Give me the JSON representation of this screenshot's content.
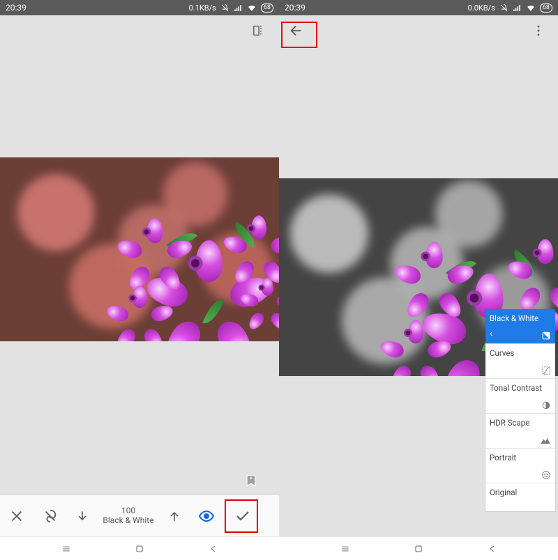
{
  "left": {
    "status": {
      "time": "20:39",
      "net": "0.1KB/s",
      "battery": "68"
    },
    "topbar_icon": "compare-icon",
    "bookmark_icon": "bookmark-add-icon",
    "toolbar": {
      "close": "close-icon",
      "mask": "mask-brush-icon",
      "down": "arrow-down-icon",
      "value": "100",
      "label": "Black & White",
      "up": "arrow-up-icon",
      "eye": "eye-icon",
      "apply": "check-icon"
    }
  },
  "right": {
    "status": {
      "time": "20:39",
      "net": "0.0KB/s",
      "battery": "68"
    },
    "menu_icon": "more-vert-icon",
    "back_icon": "arrow-back-icon",
    "stacks": [
      {
        "label": "Black & White",
        "icon": "bw-icon",
        "active": true
      },
      {
        "label": "Curves",
        "icon": "curves-icon"
      },
      {
        "label": "Tonal Contrast",
        "icon": "tonal-icon"
      },
      {
        "label": "HDR Scape",
        "icon": "hdr-icon"
      },
      {
        "label": "Portrait",
        "icon": "face-icon"
      },
      {
        "label": "Original",
        "icon": ""
      }
    ]
  },
  "navbar": {
    "recent": "recent-apps-icon",
    "home": "home-icon",
    "back": "nav-back-icon"
  }
}
